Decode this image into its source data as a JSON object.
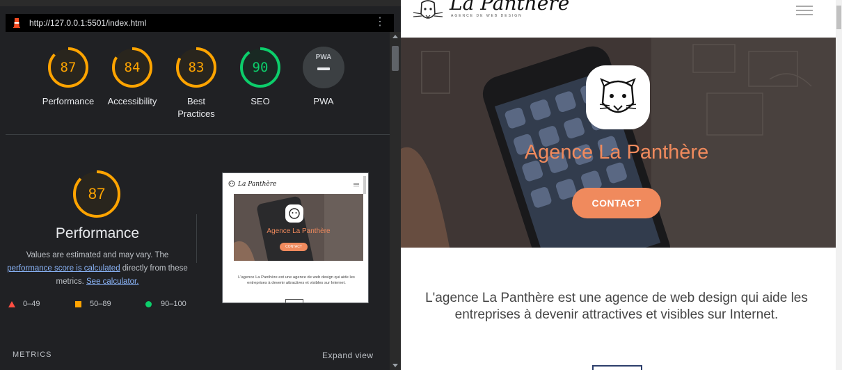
{
  "devtools": {
    "url": "http://127.0.0.1:5501/index.html",
    "menu_icon": "kebab-icon",
    "scores": [
      {
        "value": "87",
        "label": "Performance",
        "level": 87,
        "color": "#ffa400"
      },
      {
        "value": "84",
        "label": "Accessibility",
        "level": 84,
        "color": "#ffa400"
      },
      {
        "value": "83",
        "label": "Best Practices",
        "level": 83,
        "color": "#ffa400"
      },
      {
        "value": "90",
        "label": "SEO",
        "level": 90,
        "color": "#0cce6b"
      }
    ],
    "pwa": {
      "badge": "PWA",
      "label": "PWA"
    },
    "performance": {
      "score": "87",
      "level": 87,
      "title": "Performance",
      "desc_1": "Values are estimated and may vary. The",
      "link_1": "performance score is calculated",
      "desc_2": "directly from these metrics.",
      "link_2": "See calculator."
    },
    "legend": [
      {
        "range": "0–49",
        "color": "#ff4e42"
      },
      {
        "range": "50–89",
        "color": "#ffa400"
      },
      {
        "range": "90–100",
        "color": "#0cce6b"
      }
    ],
    "metrics_label": "METRICS",
    "expand_label": "Expand view",
    "thumbnail": {
      "brand": "La Panthère",
      "title": "Agence La Panthère",
      "button": "CONTACT",
      "text": "L'agence La Panthère est une agence de web design qui aide les entreprises à devenir attractives et visibles sur Internet."
    }
  },
  "site": {
    "brand": "La Panthère",
    "tagline": "AGENCE DE WEB DESIGN",
    "hero_title": "Agence La Panthère",
    "contact_button": "CONTACT",
    "intro": "L'agence La Panthère est une agence de web design qui aide les entreprises à devenir attractives et visibles sur Internet.",
    "accent_color": "#f08a5d"
  }
}
